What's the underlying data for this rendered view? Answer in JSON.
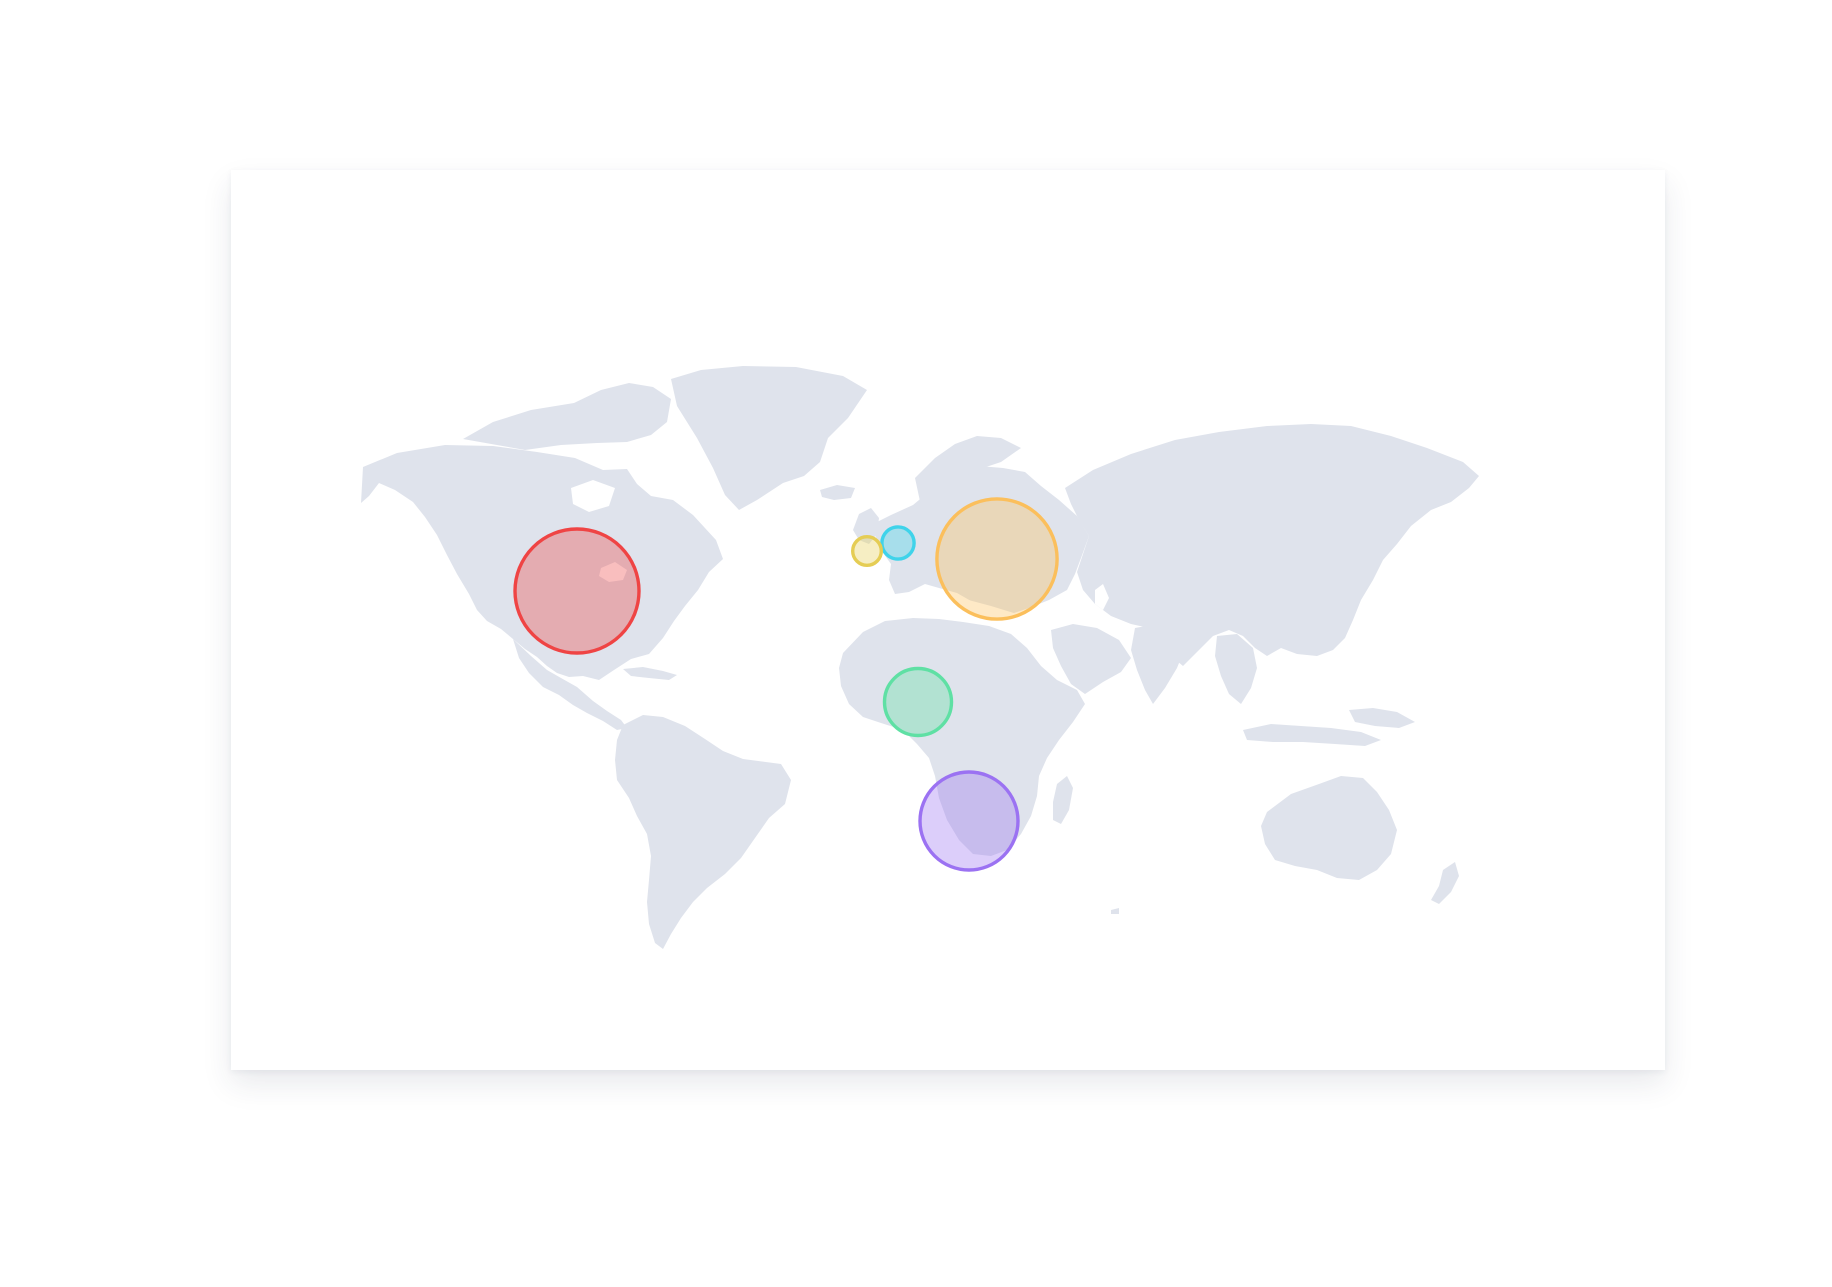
{
  "map": {
    "land_color": "#dfe3ec",
    "background_color": "#ffffff",
    "card_background": "#ffffff"
  },
  "bubbles": [
    {
      "id": "north-america",
      "color": "#ef4444",
      "size": 1.0
    },
    {
      "id": "europe-east",
      "color": "#fbbf5c",
      "size": 0.97
    },
    {
      "id": "southern-africa",
      "color": "#9b72f2",
      "size": 0.79
    },
    {
      "id": "west-africa",
      "color": "#5fe0a4",
      "size": 0.54
    },
    {
      "id": "western-europe",
      "color": "#3fd3ea",
      "size": 0.26
    },
    {
      "id": "atlantic-europe",
      "color": "#e5cd54",
      "size": 0.23
    }
  ]
}
